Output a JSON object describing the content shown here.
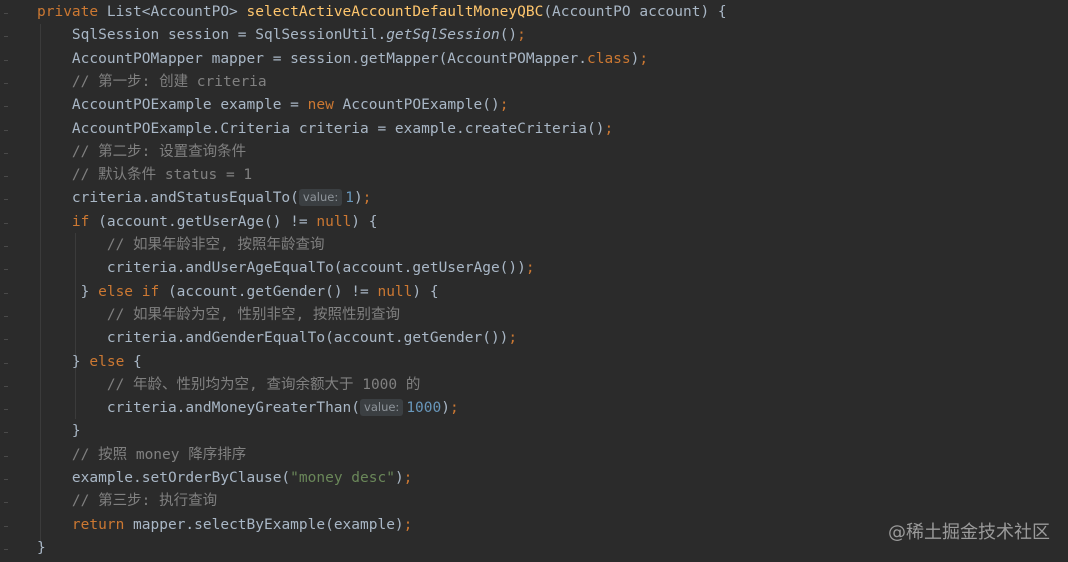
{
  "editor": {
    "lines": [
      [
        {
          "t": "private",
          "c": "kw"
        },
        {
          "t": " List<AccountPO> "
        },
        {
          "t": "selectActiveAccountDefaultMoneyQBC",
          "c": "fn"
        },
        {
          "t": "(AccountPO account) {"
        }
      ],
      [
        {
          "t": "    SqlSession session = SqlSessionUtil."
        },
        {
          "t": "getSqlSession",
          "c": "it"
        },
        {
          "t": "()"
        },
        {
          "t": ";",
          "c": "kw"
        }
      ],
      [
        {
          "t": "    AccountPOMapper mapper = session.getMapper(AccountPOMapper."
        },
        {
          "t": "class",
          "c": "kw"
        },
        {
          "t": ")"
        },
        {
          "t": ";",
          "c": "kw"
        }
      ],
      [
        {
          "t": "    // 第一步: 创建 criteria",
          "c": "cm"
        }
      ],
      [
        {
          "t": "    AccountPOExample example = "
        },
        {
          "t": "new",
          "c": "kw"
        },
        {
          "t": " AccountPOExample()"
        },
        {
          "t": ";",
          "c": "kw"
        }
      ],
      [
        {
          "t": "    AccountPOExample.Criteria criteria = example.createCriteria()"
        },
        {
          "t": ";",
          "c": "kw"
        }
      ],
      [
        {
          "t": "    // 第二步: 设置查询条件",
          "c": "cm"
        }
      ],
      [
        {
          "t": "    // 默认条件 status = 1",
          "c": "cm"
        }
      ],
      [
        {
          "t": "    criteria.andStatusEqualTo("
        },
        {
          "t": "value:",
          "c": "hint"
        },
        {
          "t": "1",
          "c": "num"
        },
        {
          "t": ")"
        },
        {
          "t": ";",
          "c": "kw"
        }
      ],
      [
        {
          "t": "    "
        },
        {
          "t": "if",
          "c": "kw"
        },
        {
          "t": " (account.getUserAge() != "
        },
        {
          "t": "null",
          "c": "kw"
        },
        {
          "t": ") {"
        }
      ],
      [
        {
          "t": "        // 如果年龄非空, 按照年龄查询",
          "c": "cm"
        }
      ],
      [
        {
          "t": "        criteria.andUserAgeEqualTo(account.getUserAge())"
        },
        {
          "t": ";",
          "c": "kw"
        }
      ],
      [
        {
          "t": "     } "
        },
        {
          "t": "else if",
          "c": "kw"
        },
        {
          "t": " (account.getGender() != "
        },
        {
          "t": "null",
          "c": "kw"
        },
        {
          "t": ") {"
        }
      ],
      [
        {
          "t": "        // 如果年龄为空, 性别非空, 按照性别查询",
          "c": "cm"
        }
      ],
      [
        {
          "t": "        criteria.andGenderEqualTo(account.getGender())"
        },
        {
          "t": ";",
          "c": "kw"
        }
      ],
      [
        {
          "t": "    } "
        },
        {
          "t": "else",
          "c": "kw"
        },
        {
          "t": " {"
        }
      ],
      [
        {
          "t": "        // 年龄、性别均为空, 查询余额大于 1000 的",
          "c": "cm"
        }
      ],
      [
        {
          "t": "        criteria.andMoneyGreaterThan("
        },
        {
          "t": "value:",
          "c": "hint"
        },
        {
          "t": "1000",
          "c": "num"
        },
        {
          "t": ")"
        },
        {
          "t": ";",
          "c": "kw"
        }
      ],
      [
        {
          "t": "    }"
        }
      ],
      [
        {
          "t": "    // 按照 money 降序排序",
          "c": "cm"
        }
      ],
      [
        {
          "t": "    example.setOrderByClause("
        },
        {
          "t": "\"money desc\"",
          "c": "str"
        },
        {
          "t": ")"
        },
        {
          "t": ";",
          "c": "kw"
        }
      ],
      [
        {
          "t": "    // 第三步: 执行查询",
          "c": "cm"
        }
      ],
      [
        {
          "t": "    "
        },
        {
          "t": "return",
          "c": "kw"
        },
        {
          "t": " mapper.selectByExample(example)"
        },
        {
          "t": ";",
          "c": "kw"
        }
      ],
      [
        {
          "t": "}"
        }
      ]
    ]
  },
  "watermark": "@稀土掘金技术社区",
  "colors": {
    "background": "#2b2b2b",
    "keyword": "#cc7832",
    "method_decl": "#ffc66d",
    "comment": "#808080",
    "string": "#6a8759",
    "number": "#6897bb",
    "default": "#a9b7c6"
  }
}
